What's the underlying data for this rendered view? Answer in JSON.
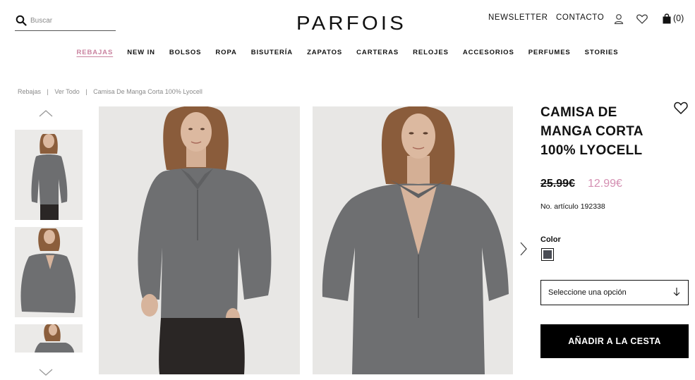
{
  "header": {
    "search_placeholder": "Buscar",
    "logo_text": "PARFOIS",
    "newsletter": "NEWSLETTER",
    "contact": "CONTACTO",
    "cart_count": "(0)"
  },
  "nav": [
    {
      "label": "REBAJAS",
      "active": true
    },
    {
      "label": "NEW IN"
    },
    {
      "label": "BOLSOS"
    },
    {
      "label": "ROPA"
    },
    {
      "label": "BISUTERÍA"
    },
    {
      "label": "ZAPATOS"
    },
    {
      "label": "CARTERAS"
    },
    {
      "label": "RELOJES"
    },
    {
      "label": "ACCESORIOS"
    },
    {
      "label": "PERFUMES"
    },
    {
      "label": "STORIES"
    }
  ],
  "breadcrumb": {
    "items": [
      "Rebajas",
      "Ver Todo",
      "Camisa De Manga Corta 100% Lyocell"
    ],
    "separator": "|"
  },
  "product": {
    "title": "CAMISA DE MANGA CORTA 100% LYOCELL",
    "old_price": "25.99€",
    "new_price": "12.99€",
    "article_label": "No. artículo",
    "article_number": "192338",
    "color_label": "Color",
    "color_swatch": "#4a4d55",
    "size_select_placeholder": "Seleccione una opción",
    "add_to_cart": "AÑADIR A LA CESTA"
  },
  "colors": {
    "sale_accent": "#c9829f",
    "price_accent": "#d48fb2",
    "shirt": "#6e6f71",
    "skin": "#d9b8a0",
    "hair": "#8b5e3c",
    "pants": "#2a2625"
  }
}
